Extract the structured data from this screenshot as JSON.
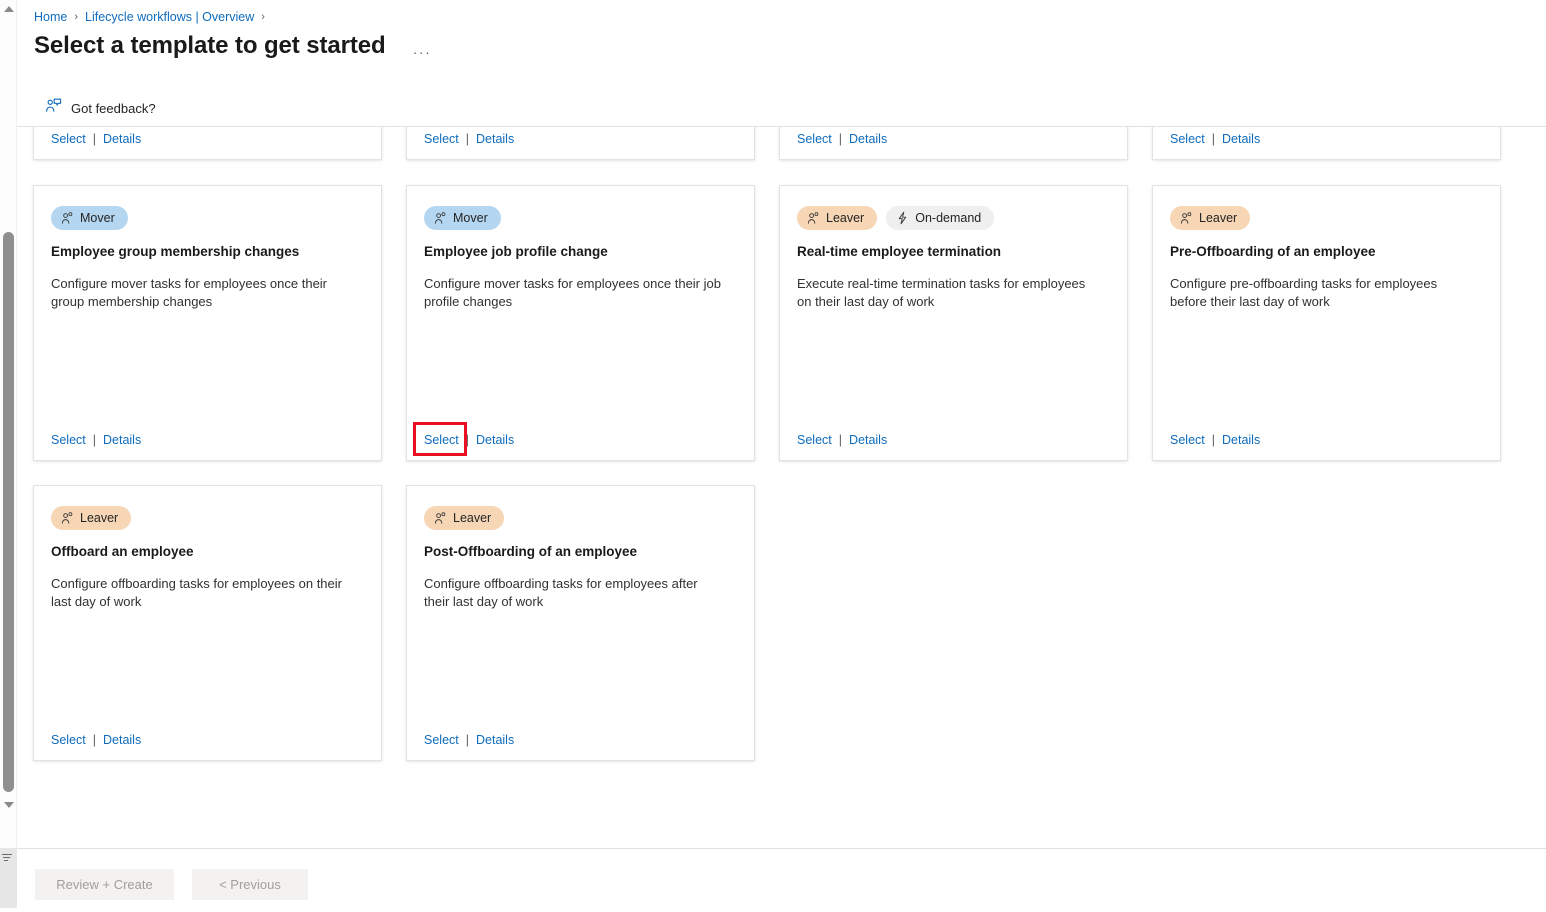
{
  "breadcrumb": {
    "home": "Home",
    "section": "Lifecycle workflows | Overview",
    "separator": "›"
  },
  "header": {
    "title": "Select a template to get started",
    "more_label": "···",
    "feedback_label": "Got feedback?"
  },
  "labels": {
    "select": "Select",
    "details": "Details",
    "action_separator": "|"
  },
  "badge_types": {
    "mover": {
      "label": "Mover",
      "color": "#b4d6f0",
      "icon": "person-icon"
    },
    "leaver": {
      "label": "Leaver",
      "color": "#f6d6b4",
      "icon": "person-icon"
    },
    "ondemand": {
      "label": "On-demand",
      "color": "#efefef",
      "icon": "lightning-bolt-icon"
    }
  },
  "rows": [
    {
      "row_name": "partially-visible-top-row",
      "cards": [
        {
          "badges": [],
          "title": "",
          "description": "",
          "select": "Select",
          "details": "Details"
        },
        {
          "badges": [],
          "title": "",
          "description": "",
          "select": "Select",
          "details": "Details"
        },
        {
          "badges": [],
          "title": "",
          "description": "",
          "select": "Select",
          "details": "Details"
        },
        {
          "badges": [],
          "title": "",
          "description": "",
          "select": "Select",
          "details": "Details"
        }
      ]
    },
    {
      "row_name": "mover-leaver-row",
      "cards": [
        {
          "badges": [
            {
              "type": "mover",
              "label": "Mover"
            }
          ],
          "title": "Employee group membership changes",
          "description": "Configure mover tasks for employees once their group membership changes",
          "select": "Select",
          "details": "Details",
          "highlighted": false
        },
        {
          "badges": [
            {
              "type": "mover",
              "label": "Mover"
            }
          ],
          "title": "Employee job profile change",
          "description": "Configure mover tasks for employees once their job profile changes",
          "select": "Select",
          "details": "Details",
          "highlighted": true
        },
        {
          "badges": [
            {
              "type": "leaver",
              "label": "Leaver"
            },
            {
              "type": "ondemand",
              "label": "On-demand"
            }
          ],
          "title": "Real-time employee termination",
          "description": "Execute real-time termination tasks for employees on their last day of work",
          "select": "Select",
          "details": "Details",
          "highlighted": false
        },
        {
          "badges": [
            {
              "type": "leaver",
              "label": "Leaver"
            }
          ],
          "title": "Pre-Offboarding of an employee",
          "description": "Configure pre-offboarding tasks for employees before their last day of work",
          "select": "Select",
          "details": "Details",
          "highlighted": false
        }
      ]
    },
    {
      "row_name": "offboarding-row",
      "cards": [
        {
          "badges": [
            {
              "type": "leaver",
              "label": "Leaver"
            }
          ],
          "title": "Offboard an employee",
          "description": "Configure offboarding tasks for employees on their last day of work",
          "select": "Select",
          "details": "Details",
          "highlighted": false
        },
        {
          "badges": [
            {
              "type": "leaver",
              "label": "Leaver"
            }
          ],
          "title": "Post-Offboarding of an employee",
          "description": "Configure offboarding tasks for employees after their last day of work",
          "select": "Select",
          "details": "Details",
          "highlighted": false
        }
      ]
    }
  ],
  "footer": {
    "review_create": "Review + Create",
    "previous": "< Previous"
  },
  "colors": {
    "link": "#0f6cbd",
    "highlight": "#e81123",
    "text": "#242424",
    "disabled_button_bg": "#f3f2f1",
    "disabled_button_text": "#a19f9d"
  }
}
